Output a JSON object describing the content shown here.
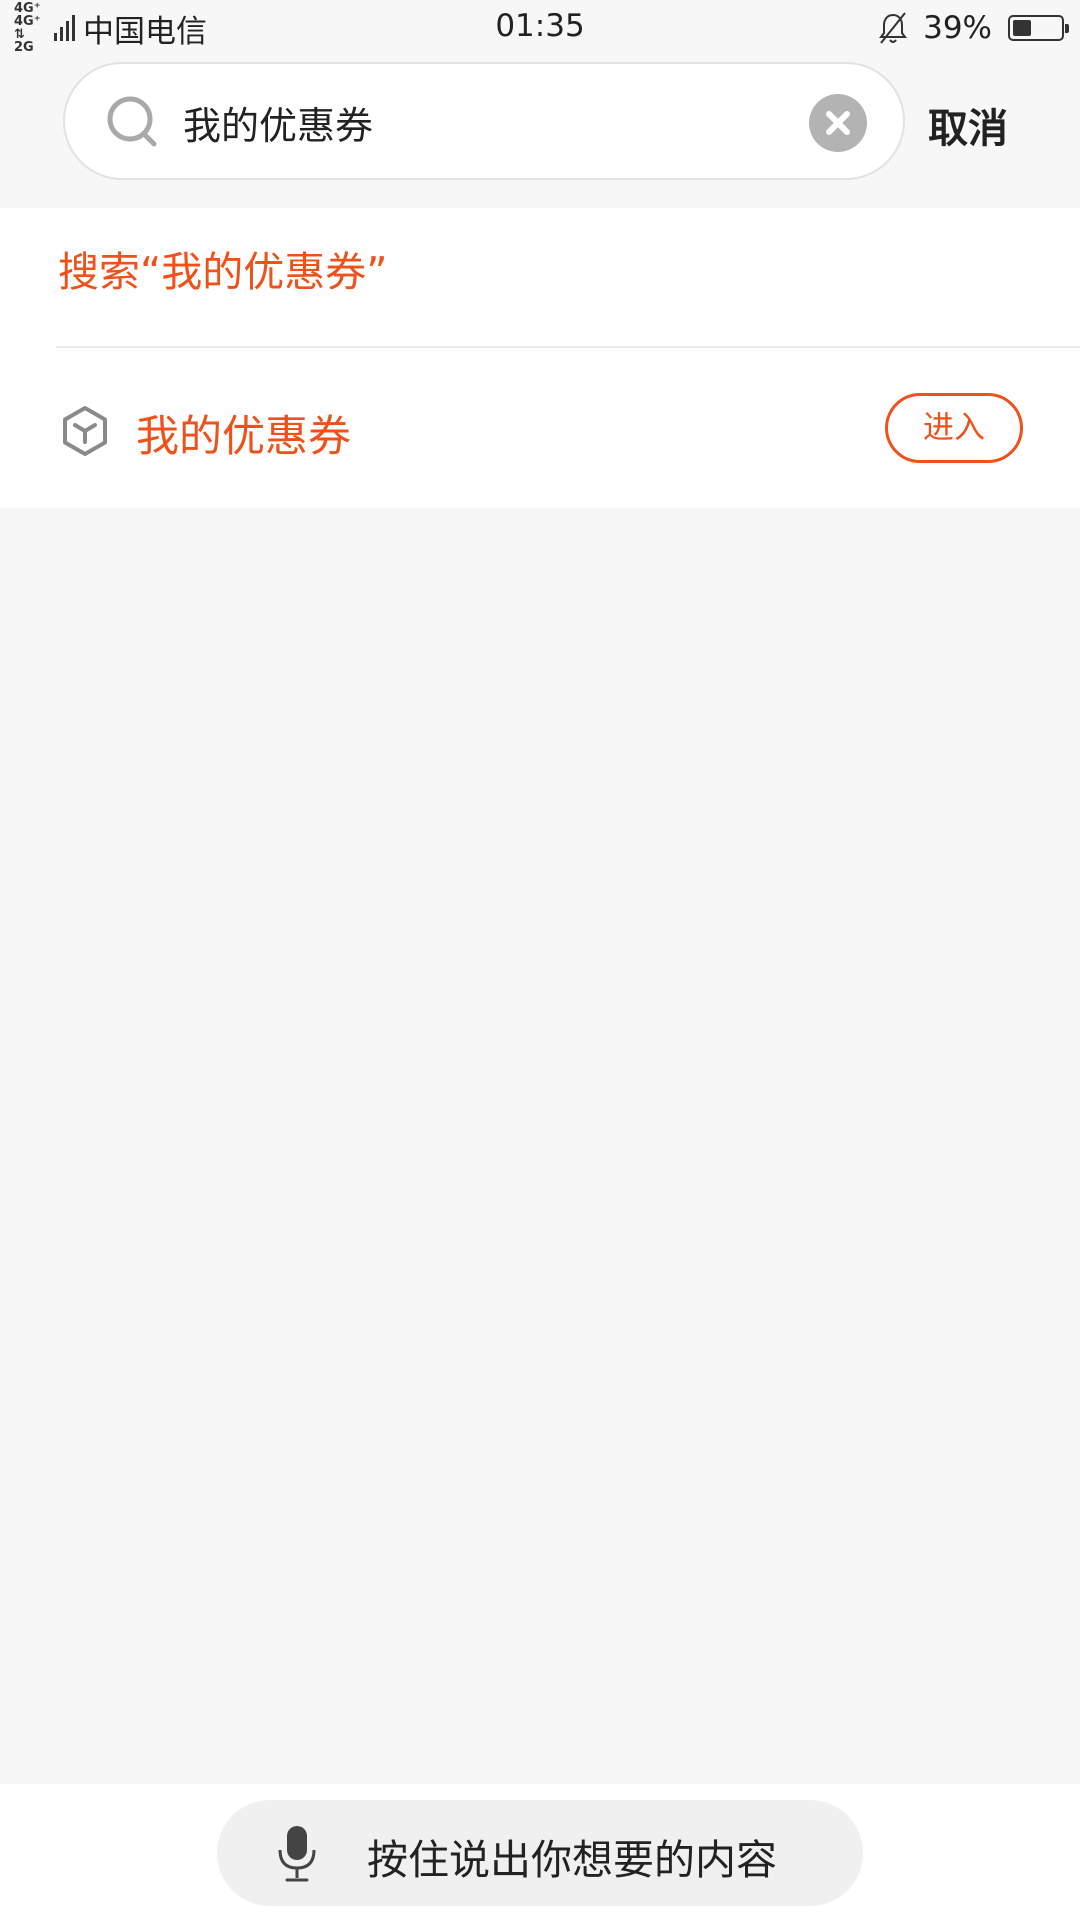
{
  "status_bar": {
    "network_badge_line1": "4G⁺ 4G⁺",
    "network_badge_line2": "⇅ 2G",
    "carrier": "中国电信",
    "time": "01:35",
    "battery_percent": "39%",
    "battery_level": 0.39,
    "icons": [
      "signal-icon",
      "bell-muted-icon",
      "battery-icon"
    ]
  },
  "search": {
    "query": "我的优惠券",
    "placeholder": "",
    "cancel_label": "取消",
    "icons": [
      "search-icon",
      "clear-icon"
    ]
  },
  "results": {
    "suggestion_text": "搜索“我的优惠券”",
    "items": [
      {
        "title": "我的优惠券",
        "action_label": "进入",
        "icon": "cube-icon"
      }
    ]
  },
  "voice": {
    "label": "按住说出你想要的内容",
    "icon": "microphone-icon"
  },
  "colors": {
    "accent": "#f0501a",
    "background": "#f7f7f7",
    "clear_button": "#b3b3b3"
  }
}
